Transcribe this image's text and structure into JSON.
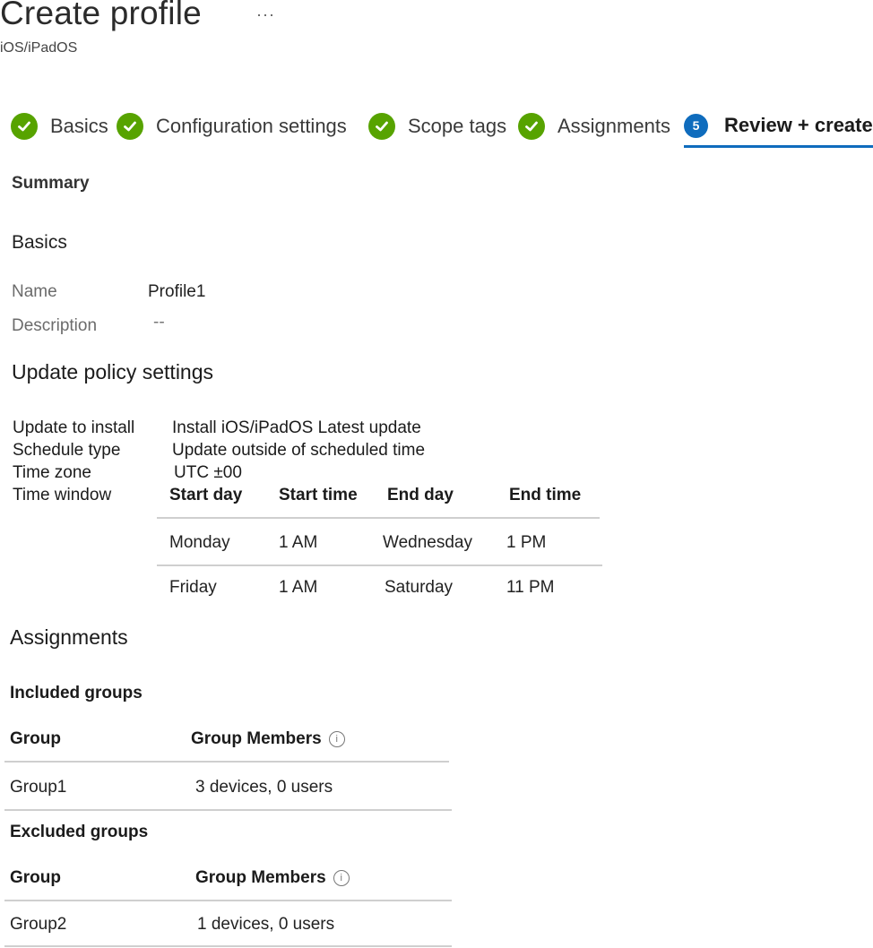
{
  "header": {
    "title": "Create profile",
    "more": "···",
    "subtitle": "iOS/iPadOS"
  },
  "steps": [
    {
      "label": "Basics",
      "state": "complete"
    },
    {
      "label": "Configuration settings",
      "state": "complete"
    },
    {
      "label": "Scope tags",
      "state": "complete"
    },
    {
      "label": "Assignments",
      "state": "complete"
    },
    {
      "label": "Review + create",
      "state": "active",
      "number": "5"
    }
  ],
  "summary_label": "Summary",
  "basics": {
    "heading": "Basics",
    "name_label": "Name",
    "name_value": "Profile1",
    "description_label": "Description",
    "description_value": "--"
  },
  "update_policy": {
    "heading": "Update policy settings",
    "update_to_install_label": "Update to install",
    "update_to_install_value": "Install iOS/iPadOS Latest update",
    "schedule_type_label": "Schedule type",
    "schedule_type_value": "Update outside of scheduled time",
    "time_zone_label": "Time zone",
    "time_zone_value": "UTC ±00",
    "time_window_label": "Time window",
    "time_window": {
      "columns": [
        "Start day",
        "Start time",
        "End day",
        "End time"
      ],
      "rows": [
        [
          "Monday",
          "1 AM",
          "Wednesday",
          "1 PM"
        ],
        [
          "Friday",
          "1 AM",
          "Saturday",
          "11 PM"
        ]
      ]
    }
  },
  "assignments": {
    "heading": "Assignments",
    "included": {
      "heading": "Included groups",
      "columns": [
        "Group",
        "Group Members"
      ],
      "rows": [
        [
          "Group1",
          "3 devices, 0 users"
        ]
      ]
    },
    "excluded": {
      "heading": "Excluded groups",
      "columns": [
        "Group",
        "Group Members"
      ],
      "rows": [
        [
          "Group2",
          "1 devices, 0 users"
        ]
      ]
    }
  },
  "colors": {
    "check_green": "#57a300",
    "accent_blue": "#0f6cbd"
  },
  "icons": {
    "more": "more-options-icon",
    "check": "checkmark-circle-icon",
    "info": "info-icon"
  }
}
